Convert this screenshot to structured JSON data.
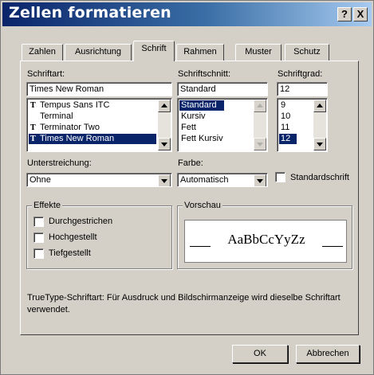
{
  "window": {
    "title": "Zellen formatieren",
    "help_label": "?",
    "close_label": "X"
  },
  "tabs": [
    {
      "label": "Zahlen",
      "active": false
    },
    {
      "label": "Ausrichtung",
      "active": false
    },
    {
      "label": "Schrift",
      "active": true
    },
    {
      "label": "Rahmen",
      "active": false
    },
    {
      "label": "Muster",
      "active": false
    },
    {
      "label": "Schutz",
      "active": false
    }
  ],
  "font": {
    "label": "Schriftart:",
    "value": "Times New Roman",
    "items": [
      {
        "label": "Tempus Sans ITC",
        "truetype": true,
        "selected": false
      },
      {
        "label": "Terminal",
        "truetype": false,
        "selected": false
      },
      {
        "label": "Terminator Two",
        "truetype": true,
        "selected": false
      },
      {
        "label": "Times New Roman",
        "truetype": true,
        "selected": true
      }
    ]
  },
  "style": {
    "label": "Schriftschnitt:",
    "value": "Standard",
    "items": [
      {
        "label": "Standard",
        "selected": true
      },
      {
        "label": "Kursiv",
        "selected": false
      },
      {
        "label": "Fett",
        "selected": false
      },
      {
        "label": "Fett Kursiv",
        "selected": false
      }
    ]
  },
  "size": {
    "label": "Schriftgrad:",
    "value": "12",
    "items": [
      {
        "label": "9",
        "selected": false
      },
      {
        "label": "10",
        "selected": false
      },
      {
        "label": "11",
        "selected": false
      },
      {
        "label": "12",
        "selected": true
      }
    ]
  },
  "underline": {
    "label": "Unterstreichung:",
    "value": "Ohne"
  },
  "color": {
    "label": "Farbe:",
    "value": "Automatisch"
  },
  "standard_font": {
    "label": "Standardschrift",
    "checked": false
  },
  "effects": {
    "title": "Effekte",
    "items": [
      {
        "label": "Durchgestrichen",
        "checked": false
      },
      {
        "label": "Hochgestellt",
        "checked": false
      },
      {
        "label": "Tiefgestellt",
        "checked": false
      }
    ]
  },
  "preview": {
    "title": "Vorschau",
    "sample": "AaBbCcYyZz"
  },
  "info_text": "TrueType-Schriftart: Für Ausdruck und Bildschirmanzeige wird dieselbe Schriftart verwendet.",
  "buttons": {
    "ok": "OK",
    "cancel": "Abbrechen"
  }
}
